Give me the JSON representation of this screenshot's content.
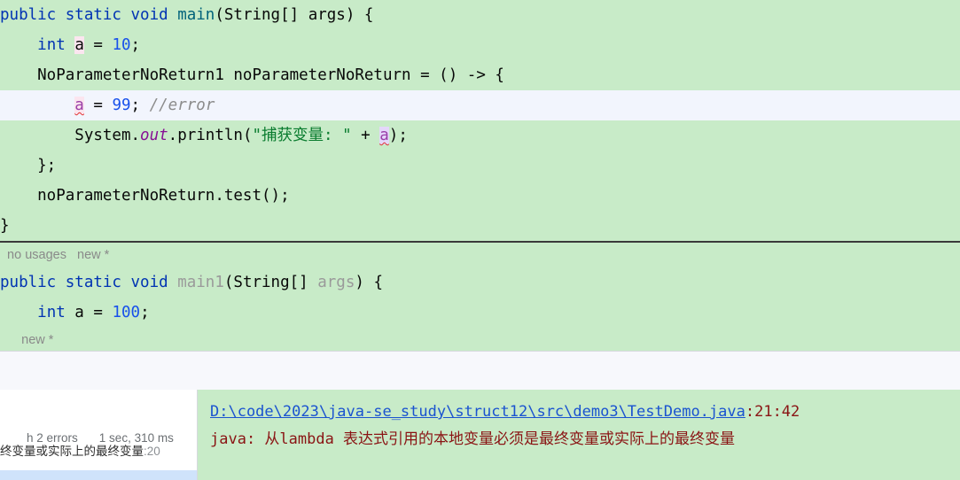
{
  "editor": {
    "lines": [
      {
        "type": "code",
        "highlight": false,
        "indent": "",
        "tokens": [
          {
            "t": "public static void ",
            "c": "kw"
          },
          {
            "t": "main",
            "c": "mname"
          },
          {
            "t": "(String[] args) {",
            "c": "plain"
          }
        ],
        "text": "public static void main(String[] args) {"
      },
      {
        "type": "code",
        "highlight": false,
        "tokens": [
          {
            "t": "    ",
            "c": "plain"
          },
          {
            "t": "int",
            "c": "kw"
          },
          {
            "t": " ",
            "c": "plain"
          },
          {
            "t": "a",
            "c": "plain hl-pink"
          },
          {
            "t": " = ",
            "c": "plain"
          },
          {
            "t": "10",
            "c": "num"
          },
          {
            "t": ";",
            "c": "plain"
          }
        ],
        "text": "    int a = 10;"
      },
      {
        "type": "code",
        "highlight": false,
        "tokens": [
          {
            "t": "    NoParameterNoReturn1 noParameterNoReturn = () -> {",
            "c": "plain"
          }
        ],
        "text": "    NoParameterNoReturn1 noParameterNoReturn = () -> {"
      },
      {
        "type": "code",
        "highlight": true,
        "tokens": [
          {
            "t": "        ",
            "c": "plain"
          },
          {
            "t": "a",
            "c": "err-id hl-pink squiggle"
          },
          {
            "t": " = ",
            "c": "plain"
          },
          {
            "t": "99",
            "c": "num"
          },
          {
            "t": "; ",
            "c": "plain"
          },
          {
            "t": "//error",
            "c": "cmt"
          }
        ],
        "text": "        a = 99; //error"
      },
      {
        "type": "code",
        "highlight": false,
        "tokens": [
          {
            "t": "        System.",
            "c": "plain"
          },
          {
            "t": "out",
            "c": "fld"
          },
          {
            "t": ".println(",
            "c": "plain"
          },
          {
            "t": "\"捕获变量: \"",
            "c": "str"
          },
          {
            "t": " + ",
            "c": "plain"
          },
          {
            "t": "a",
            "c": "err-id hl-lav squiggle"
          },
          {
            "t": ");",
            "c": "plain"
          }
        ],
        "text": "        System.out.println(\"捕获变量: \" + a);"
      },
      {
        "type": "code",
        "highlight": false,
        "tokens": [
          {
            "t": "    };",
            "c": "plain"
          }
        ],
        "text": "    };"
      },
      {
        "type": "code",
        "highlight": false,
        "tokens": [
          {
            "t": "    noParameterNoReturn.test();",
            "c": "plain"
          }
        ],
        "text": "    noParameterNoReturn.test();"
      },
      {
        "type": "code",
        "highlight": false,
        "tokens": [
          {
            "t": "}",
            "c": "plain"
          }
        ],
        "text": "}"
      },
      {
        "type": "separator"
      },
      {
        "type": "inlay",
        "text": "  no usages   new *"
      },
      {
        "type": "code",
        "highlight": false,
        "tokens": [
          {
            "t": "public static void ",
            "c": "kw"
          },
          {
            "t": "main1",
            "c": "grey"
          },
          {
            "t": "(String[] ",
            "c": "plain"
          },
          {
            "t": "args",
            "c": "grey"
          },
          {
            "t": ") {",
            "c": "plain"
          }
        ],
        "text": "public static void main1(String[] args) {"
      },
      {
        "type": "code",
        "highlight": false,
        "tokens": [
          {
            "t": "    ",
            "c": "plain"
          },
          {
            "t": "int",
            "c": "kw"
          },
          {
            "t": " a = ",
            "c": "plain"
          },
          {
            "t": "100",
            "c": "num"
          },
          {
            "t": ";",
            "c": "plain"
          }
        ],
        "text": "    int a = 100;"
      },
      {
        "type": "inlay",
        "text": "      new *"
      }
    ]
  },
  "build_panel": {
    "tree": {
      "summary_errors": "h 2 errors",
      "summary_duration": "1 sec, 310 ms",
      "selected_message": "终变量或实际上的最终变量",
      "selected_line_suffix": ":20"
    },
    "detail": {
      "file_path": "D:\\code\\2023\\java-se_study\\struct12\\src\\demo3\\TestDemo.java",
      "position": ":21:42",
      "message": "java: 从lambda 表达式引用的本地变量必须是最终变量或实际上的最终变量"
    }
  },
  "colors": {
    "editor_bg": "#c8ebc8",
    "caret_row_bg": "#f2f5fd",
    "keyword": "#0033b3",
    "method_name": "#00627a",
    "number": "#1750eb",
    "string": "#0a7c2f",
    "comment": "#8c8c8c",
    "static_field": "#871094",
    "unused_grey": "#9a9a9a",
    "error_red": "#8a1414",
    "link_blue": "#1a53d0",
    "selection_blue": "#cfe3fb"
  }
}
